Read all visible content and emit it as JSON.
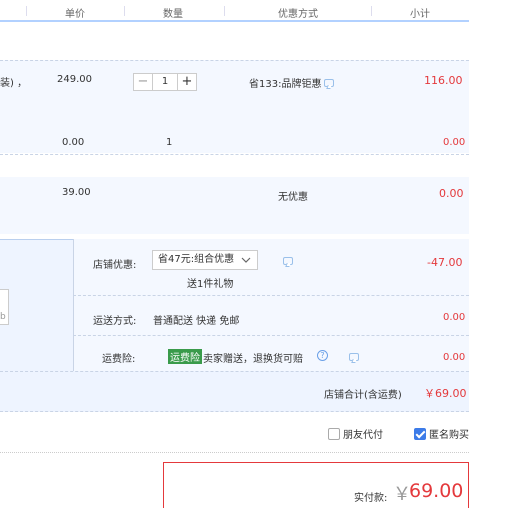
{
  "header": {
    "col_price": "单价",
    "col_qty": "数量",
    "col_promo": "优惠方式",
    "col_subtotal": "小计"
  },
  "items": [
    {
      "name_fragment": "装) ，",
      "price": "249.00",
      "qty": "1",
      "promo": "省133:品牌钜惠",
      "subtotal": "116.00"
    },
    {
      "price": "0.00",
      "qty": "1",
      "subtotal": "0.00"
    },
    {
      "price": "39.00",
      "promo": "无优惠",
      "subtotal": "0.00"
    }
  ],
  "shop": {
    "discount_label": "店铺优惠:",
    "discount_select": "省47元:组合优惠",
    "gift_note": "送1件礼物",
    "discount_amount": "-47.00",
    "shipping_label": "运送方式:",
    "shipping_value": "普通配送 快递 免邮",
    "shipping_amount": "0.00",
    "insurance_label": "运费险:",
    "insurance_tag": "运费险",
    "insurance_text": "卖家赠送，退换货可赔",
    "insurance_amount": "0.00",
    "total_label": "店铺合计(含运费)",
    "total_value": "￥69.00",
    "text_field_fragment": "b"
  },
  "options": {
    "friend_pay": "朋友代付",
    "friend_pay_checked": false,
    "anon_buy": "匿名购买",
    "anon_buy_checked": true
  },
  "payment": {
    "label": "实付款:",
    "currency": "￥",
    "amount": "69.00"
  },
  "colors": {
    "accent_red": "#e4393c",
    "row_bg": "#f4f8ff",
    "header_line": "#b2d1ff",
    "checkbox_blue": "#3c7be8"
  }
}
